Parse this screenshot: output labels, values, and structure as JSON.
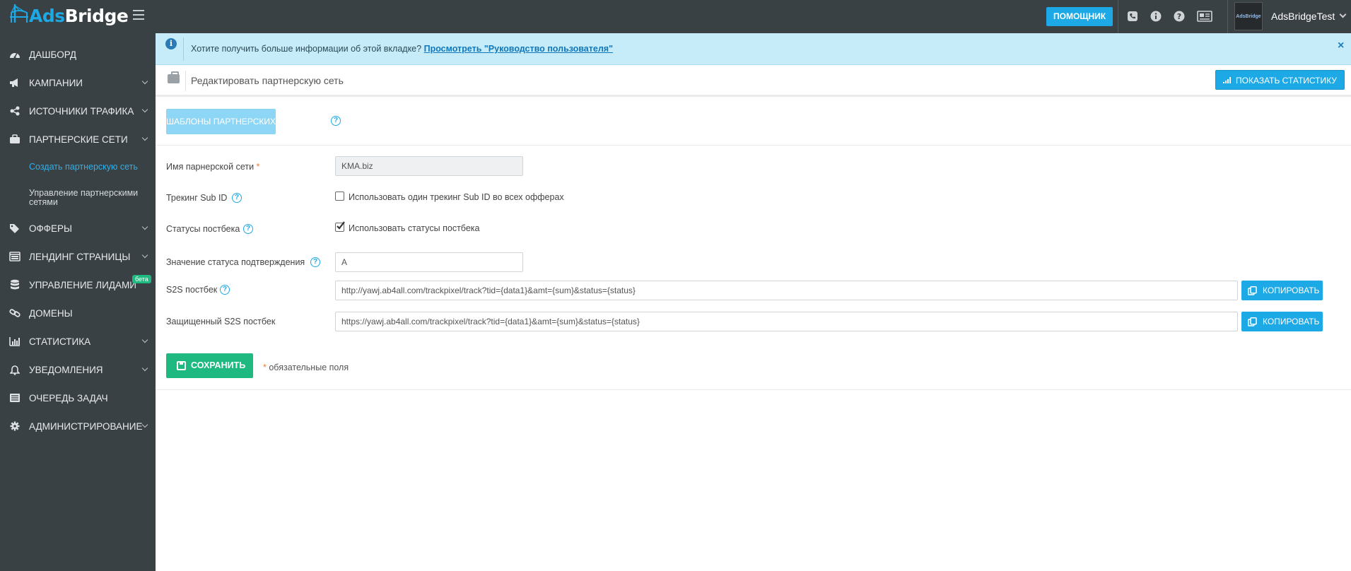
{
  "app": {
    "logo_ads": "Ads",
    "logo_bridge": "Bridge"
  },
  "topbar": {
    "helper_label": "ПОМОЩНИК",
    "username": "AdsBridgeTest",
    "avatar_text": "AdsBridge",
    "icons": [
      "phone-icon",
      "info-icon",
      "help-icon",
      "news-icon"
    ]
  },
  "sidebar": {
    "items": [
      {
        "label": "ДАШБОРД",
        "icon": "dashboard-icon",
        "has_chevron": false
      },
      {
        "label": "КАМПАНИИ",
        "icon": "megaphone-icon",
        "has_chevron": true
      },
      {
        "label": "ИСТОЧНИКИ ТРАФИКА",
        "icon": "share-icon",
        "has_chevron": true
      },
      {
        "label": "ПАРТНЕРСКИЕ СЕТИ",
        "icon": "briefcase-icon",
        "has_chevron": true
      },
      {
        "label": "ОФФЕРЫ",
        "icon": "tags-icon",
        "has_chevron": true
      },
      {
        "label": "ЛЕНДИНГ СТРАНИЦЫ",
        "icon": "landing-icon",
        "has_chevron": true
      },
      {
        "label": "УПРАВЛЕНИЕ ЛИДАМИ",
        "icon": "database-icon",
        "has_chevron": false,
        "badge": "бета"
      },
      {
        "label": "ДОМЕНЫ",
        "icon": "link-icon",
        "has_chevron": false
      },
      {
        "label": "СТАТИСТИКА",
        "icon": "bar-chart-icon",
        "has_chevron": true
      },
      {
        "label": "УВЕДОМЛЕНИЯ",
        "icon": "bell-icon",
        "has_chevron": true
      },
      {
        "label": "ОЧЕРЕДЬ ЗАДАЧ",
        "icon": "queue-icon",
        "has_chevron": false
      },
      {
        "label": "АДМИНИСТРИРОВАНИЕ",
        "icon": "gear-icon",
        "has_chevron": true
      }
    ],
    "sub_items": [
      {
        "label": "Создать партнерскую сеть",
        "active": true
      },
      {
        "label": "Управление партнерскими сетями",
        "active": false
      }
    ]
  },
  "info_bar": {
    "text": "Хотите получить больше информации об этой вкладке?",
    "link": "Просмотреть \"Руководство пользователя\"",
    "close": "×"
  },
  "header": {
    "title": "Редактировать партнерскую сеть",
    "stats_button": "ПОКАЗАТЬ СТАТИСТИКУ"
  },
  "templates_button": "ШАБЛОНЫ ПАРТНЕРСКИХ СЕТЕЙ",
  "form": {
    "network_name_label": "Имя парнерской сети",
    "network_name_value": "KMA.biz",
    "subid_label": "Трекинг Sub ID",
    "subid_checkbox_label": "Использовать один трекинг Sub ID во всех офферах",
    "subid_checked": false,
    "postback_status_label": "Статусы постбека",
    "postback_status_checkbox_label": "Использовать статусы постбека",
    "postback_status_checked": true,
    "confirm_status_label": "Значение статуса подтверждения",
    "confirm_status_value": "A",
    "s2s_label": "S2S постбек",
    "s2s_value": "http://yawj.ab4all.com/trackpixel/track?tid={data1}&amt={sum}&status={status}",
    "secure_s2s_label": "Защищенный S2S постбек",
    "secure_s2s_value": "https://yawj.ab4all.com/trackpixel/track?tid={data1}&amt={sum}&status={status}",
    "copy_label": "КОПИРОВАТЬ",
    "save_label": "СОХРАНИТЬ",
    "required_note": "обязательные поля",
    "required_mark": "*"
  },
  "colors": {
    "accent": "#1ca9e6",
    "success": "#1eb980",
    "sidebar_bg": "#3a4145",
    "info_bg": "#c5ecf8"
  }
}
